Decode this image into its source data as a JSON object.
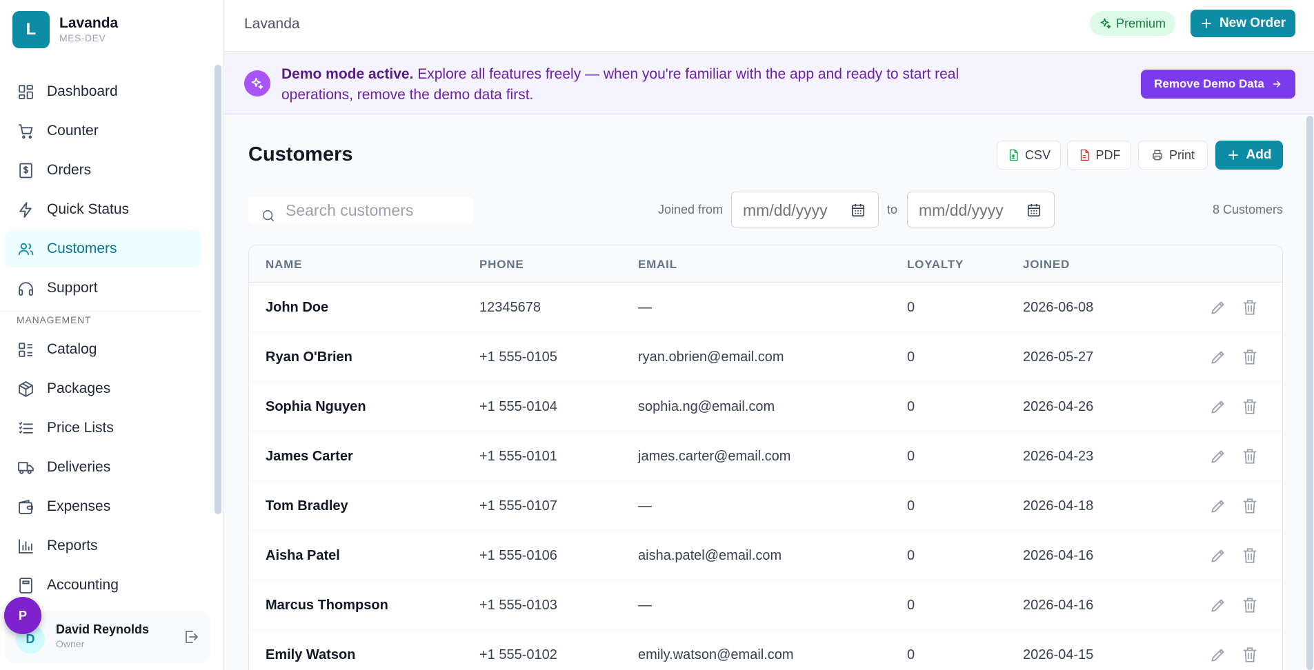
{
  "brand": {
    "logo_letter": "L",
    "name": "Lavanda",
    "sub": "MES-DEV"
  },
  "nav": {
    "items": [
      {
        "label": "Dashboard",
        "icon": "dashboard-icon"
      },
      {
        "label": "Counter",
        "icon": "cart-icon"
      },
      {
        "label": "Orders",
        "icon": "receipt-icon"
      },
      {
        "label": "Quick Status",
        "icon": "bolt-icon"
      },
      {
        "label": "Customers",
        "icon": "users-icon",
        "active": true
      },
      {
        "label": "Support",
        "icon": "headphones-icon"
      }
    ],
    "section_label": "MANAGEMENT",
    "management_items": [
      {
        "label": "Catalog",
        "icon": "catalog-icon"
      },
      {
        "label": "Packages",
        "icon": "package-icon"
      },
      {
        "label": "Price Lists",
        "icon": "list-icon"
      },
      {
        "label": "Deliveries",
        "icon": "truck-icon"
      },
      {
        "label": "Expenses",
        "icon": "wallet-icon"
      },
      {
        "label": "Reports",
        "icon": "bar-chart-icon"
      },
      {
        "label": "Accounting",
        "icon": "calculator-icon"
      }
    ]
  },
  "user": {
    "avatar_letter": "D",
    "name": "David Reynolds",
    "role": "Owner",
    "float_letter": "P"
  },
  "topbar": {
    "title": "Lavanda",
    "premium_label": "Premium",
    "new_order_label": "New Order"
  },
  "banner": {
    "bold": "Demo mode active.",
    "text": " Explore all features freely — when you're familiar with the app and ready to start real operations, remove the demo data first.",
    "button": "Remove Demo Data"
  },
  "page": {
    "title": "Customers",
    "csv": "CSV",
    "pdf": "PDF",
    "print": "Print",
    "add": "Add",
    "search_placeholder": "Search customers",
    "joined_from": "Joined from",
    "to": "to",
    "date_placeholder": "mm/dd/yyyy",
    "count": "8 Customers"
  },
  "table": {
    "headers": [
      "NAME",
      "PHONE",
      "EMAIL",
      "LOYALTY",
      "JOINED"
    ],
    "rows": [
      {
        "name": "John Doe",
        "phone": "12345678",
        "email": "—",
        "loyalty": "0",
        "joined": "2026-06-08"
      },
      {
        "name": "Ryan O'Brien",
        "phone": "+1 555-0105",
        "email": "ryan.obrien@email.com",
        "loyalty": "0",
        "joined": "2026-05-27"
      },
      {
        "name": "Sophia Nguyen",
        "phone": "+1 555-0104",
        "email": "sophia.ng@email.com",
        "loyalty": "0",
        "joined": "2026-04-26"
      },
      {
        "name": "James Carter",
        "phone": "+1 555-0101",
        "email": "james.carter@email.com",
        "loyalty": "0",
        "joined": "2026-04-23"
      },
      {
        "name": "Tom Bradley",
        "phone": "+1 555-0107",
        "email": "—",
        "loyalty": "0",
        "joined": "2026-04-18"
      },
      {
        "name": "Aisha Patel",
        "phone": "+1 555-0106",
        "email": "aisha.patel@email.com",
        "loyalty": "0",
        "joined": "2026-04-16"
      },
      {
        "name": "Marcus Thompson",
        "phone": "+1 555-0103",
        "email": "—",
        "loyalty": "0",
        "joined": "2026-04-16"
      },
      {
        "name": "Emily Watson",
        "phone": "+1 555-0102",
        "email": "emily.watson@email.com",
        "loyalty": "0",
        "joined": "2026-04-15"
      }
    ]
  },
  "colors": {
    "accent": "#0e8ba5",
    "demo": "#7c3aed",
    "premium_bg": "#dcfce7",
    "active_bg": "#ecfeff"
  }
}
